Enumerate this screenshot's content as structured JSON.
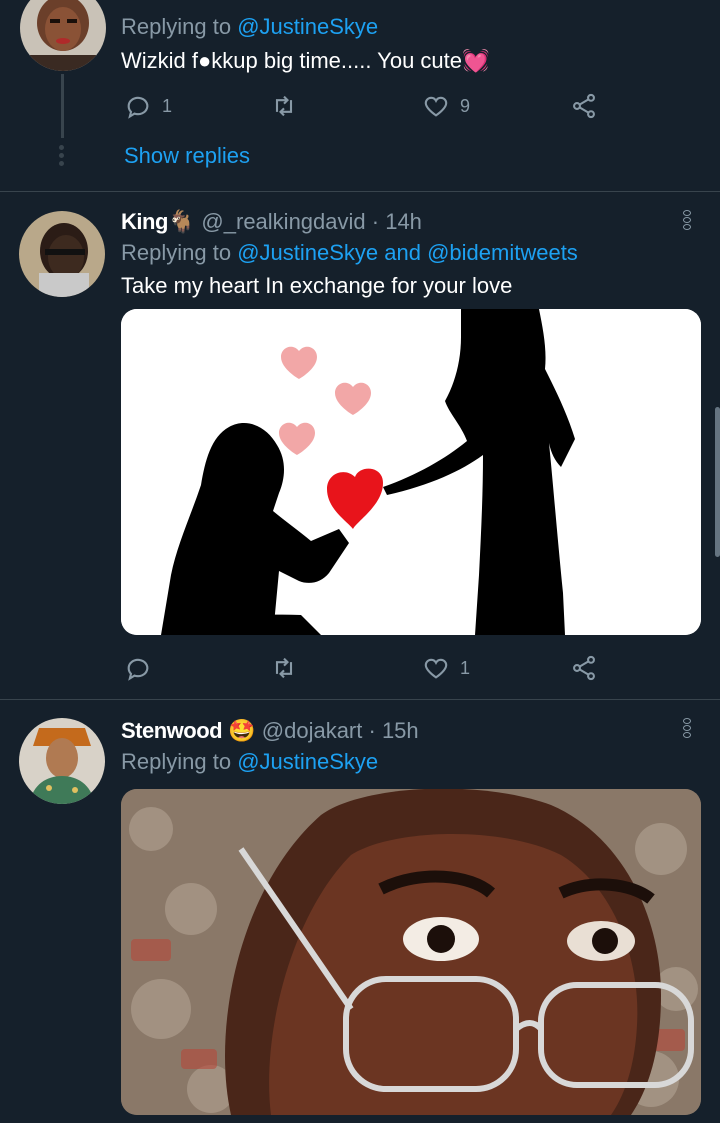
{
  "tweets": [
    {
      "replying_prefix": "Replying to",
      "replying_to": "@JustineSkye",
      "text": "Wizkid f●kkup big time..... You cute",
      "text_emoji": "💓",
      "replies": "1",
      "retweets": "",
      "likes": "9",
      "show_replies": "Show replies"
    },
    {
      "name": "King",
      "name_emoji": "🐐",
      "handle": "@_realkingdavid",
      "time": "· 14h",
      "replying_prefix": "Replying to",
      "replying_to": "@JustineSkye and @bidemitweets",
      "text": "Take my heart In exchange for your love",
      "replies": "",
      "retweets": "",
      "likes": "1"
    },
    {
      "name": "Stenwood",
      "name_emoji": "🤩",
      "handle": "@dojakart",
      "time": "· 15h",
      "replying_prefix": "Replying to",
      "replying_to": "@JustineSkye"
    }
  ],
  "colors": {
    "background": "#15202b",
    "divider": "#38444d",
    "link": "#1da1f2",
    "muted": "#8899a6"
  },
  "icons": [
    "reply-icon",
    "retweet-icon",
    "like-icon",
    "share-icon",
    "more-options-icon",
    "thread-dots-icon"
  ]
}
